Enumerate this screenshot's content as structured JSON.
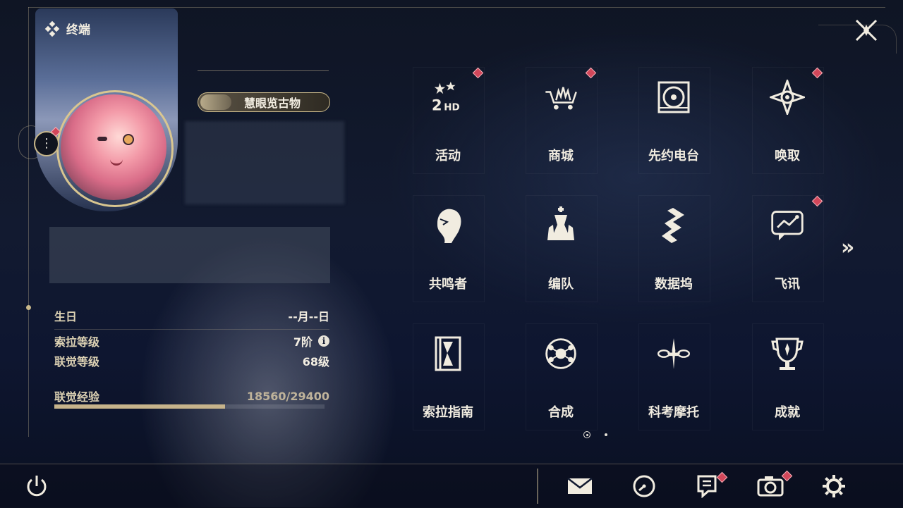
{
  "header": {
    "title": "终端"
  },
  "profile": {
    "title_badge": "慧眼览古物",
    "birthday": {
      "label": "生日",
      "value": "--月--日"
    },
    "sola_level": {
      "label": "索拉等级",
      "value": "7阶"
    },
    "union_level": {
      "label": "联觉等级",
      "value": "68级"
    },
    "union_exp": {
      "label": "联觉经验",
      "value": "18560/29400",
      "current": 18560,
      "max": 29400
    }
  },
  "grid": {
    "items": [
      {
        "label": "活动",
        "icon": "event-2hd-icon",
        "badge": true
      },
      {
        "label": "商城",
        "icon": "shop-cart-icon",
        "badge": true
      },
      {
        "label": "先约电台",
        "icon": "radio-record-icon",
        "badge": false
      },
      {
        "label": "唤取",
        "icon": "convene-star-icon",
        "badge": true
      },
      {
        "label": "共鸣者",
        "icon": "resonator-head-icon",
        "badge": false
      },
      {
        "label": "编队",
        "icon": "chess-team-icon",
        "badge": false
      },
      {
        "label": "数据坞",
        "icon": "data-bank-icon",
        "badge": false
      },
      {
        "label": "飞讯",
        "icon": "chat-message-icon",
        "badge": true
      },
      {
        "label": "索拉指南",
        "icon": "guide-book-icon",
        "badge": false
      },
      {
        "label": "合成",
        "icon": "synthesis-icon",
        "badge": false
      },
      {
        "label": "科考摩托",
        "icon": "motorcycle-icon",
        "badge": false
      },
      {
        "label": "成就",
        "icon": "trophy-icon",
        "badge": false
      }
    ]
  },
  "pagination": {
    "current": 1,
    "total": 2
  },
  "bottom_bar": {
    "icons": [
      "power-icon",
      "mail-icon",
      "time-icon",
      "notice-icon",
      "camera-icon",
      "settings-icon"
    ]
  },
  "colors": {
    "accent": "#c9b88a",
    "badge": "#d2475a",
    "text": "#f1ece0"
  }
}
